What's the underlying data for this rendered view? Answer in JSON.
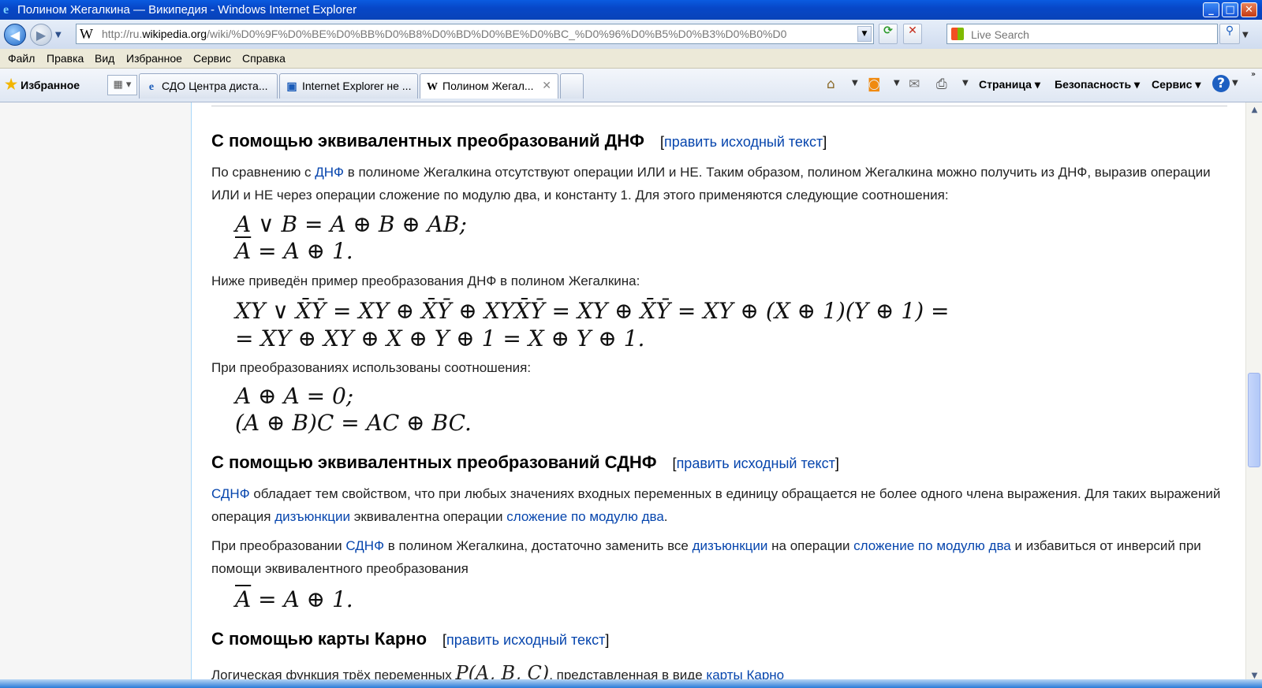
{
  "window": {
    "title": "Полином Жегалкина — Википедия - Windows Internet Explorer",
    "minimize": "_",
    "maximize": "□",
    "close": "✕"
  },
  "address": {
    "url_prefix": "http://ru.",
    "url_domain": "wikipedia.org",
    "url_rest": "/wiki/%D0%9F%D0%BE%D0%BB%D0%B8%D0%BD%D0%BE%D0%BC_%D0%96%D0%B5%D0%B3%D0%B0%D0",
    "search_placeholder": "Live Search"
  },
  "menu": [
    "Файл",
    "Правка",
    "Вид",
    "Избранное",
    "Сервис",
    "Справка"
  ],
  "toolbar": {
    "favorites": "Избранное",
    "tabs": [
      {
        "label": "СДО Центра диста..."
      },
      {
        "label": "Internet Explorer не ..."
      },
      {
        "label": "Полином Жегал..."
      }
    ],
    "page": "Страница",
    "security": "Безопасность",
    "service": "Сервис"
  },
  "article": {
    "edit_source": "править исходный текст",
    "s1": {
      "title": "С помощью эквивалентных преобразований ДНФ",
      "p1_a": "По сравнению с ",
      "p1_link": "ДНФ",
      "p1_b": " в полиноме Жегалкина отсутствуют операции ИЛИ и НЕ. Таким образом, полином Жегалкина можно получить из ДНФ, выразив операции ИЛИ и НЕ через операции сложение по модулю два, и константу 1. Для этого применяются следующие соотношения:",
      "f1": "A ∨ B = A ⊕ B ⊕ AB;",
      "f2_tail": " = A ⊕ 1.",
      "p2": "Ниже приведён пример преобразования ДНФ в полином Жегалкина:",
      "f3": "XY ∨ X̄Ȳ = XY ⊕ X̄Ȳ ⊕ XYX̄Ȳ = XY ⊕ X̄Ȳ = XY ⊕ (X ⊕ 1)(Y ⊕ 1) =",
      "f4": "= XY ⊕ XY ⊕ X ⊕ Y ⊕ 1 = X ⊕ Y ⊕ 1.",
      "p3": "При преобразованиях использованы соотношения:",
      "f5": "A ⊕ A = 0;",
      "f6": "(A ⊕ B)C = AC ⊕ BC."
    },
    "s2": {
      "title": "С помощью эквивалентных преобразований СДНФ",
      "p1_link1": "СДНФ",
      "p1_a": " обладает тем свойством, что при любых значениях входных переменных в единицу обращается не более одного члена выражения. Для таких выражений операция ",
      "p1_link2": "дизъюнкции",
      "p1_b": " эквивалентна операции ",
      "p1_link3": "сложение по модулю два",
      "p1_c": ".",
      "p2_a": "При преобразовании ",
      "p2_link1": "СДНФ",
      "p2_b": " в полином Жегалкина, достаточно заменить все ",
      "p2_link2": "дизъюнкции",
      "p2_c": " на операции ",
      "p2_link3": "сложение по модулю два",
      "p2_d": " и избавиться от инверсий при помощи эквивалентного преобразования",
      "f1_tail": " = A ⊕ 1."
    },
    "s3": {
      "title": "С помощью карты Карно",
      "p1_a": "Логическая функция трёх переменных ",
      "p1_f": "P(A, B, C)",
      "p1_b": ", представленная в виде ",
      "p1_link": "карты Карно"
    }
  }
}
